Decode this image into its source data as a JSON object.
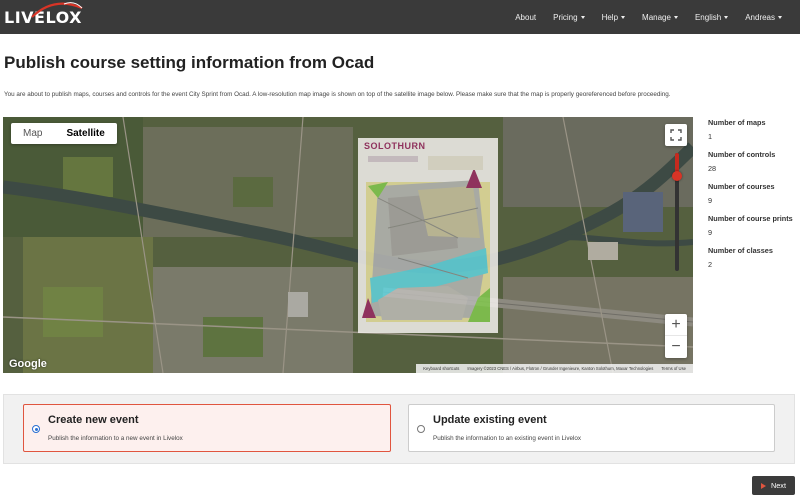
{
  "brand": {
    "name": "LIVELOX",
    "accent": "#d83426"
  },
  "nav": {
    "items": [
      {
        "label": "About",
        "dropdown": false
      },
      {
        "label": "Pricing",
        "dropdown": true
      },
      {
        "label": "Help",
        "dropdown": true
      },
      {
        "label": "Manage",
        "dropdown": true
      },
      {
        "label": "English",
        "dropdown": true
      },
      {
        "label": "Andreas",
        "dropdown": true
      }
    ]
  },
  "page": {
    "title": "Publish course setting information from Ocad",
    "intro": "You are about to publish maps, courses and controls for the event City Sprint from Ocad. A low-resolution map image is shown on top of the satellite image below. Please make sure that the map is properly georeferenced before proceeding."
  },
  "map": {
    "type_control": {
      "map_label": "Map",
      "satellite_label": "Satellite",
      "selected": "Satellite"
    },
    "overlay_title": "SOLOTHURN",
    "overlay_opacity": 0.85,
    "google_logo": "Google",
    "attribution": {
      "shortcuts": "Keyboard shortcuts",
      "imagery": "Imagery ©2023 CNES / Airbus, Flotron / Grunder Ingenieure, Kanton Solothurn, Maxar Technologies",
      "terms": "Terms of Use"
    },
    "icons": {
      "fullscreen": "fullscreen-icon",
      "zoom_in": "+",
      "zoom_out": "−"
    }
  },
  "stats": [
    {
      "label": "Number of maps",
      "value": "1"
    },
    {
      "label": "Number of controls",
      "value": "28"
    },
    {
      "label": "Number of courses",
      "value": "9"
    },
    {
      "label": "Number of course prints",
      "value": "9"
    },
    {
      "label": "Number of classes",
      "value": "2"
    }
  ],
  "options": [
    {
      "title": "Create new event",
      "description": "Publish the information to a new event in Livelox",
      "selected": true
    },
    {
      "title": "Update existing event",
      "description": "Publish the information to an existing event in Livelox",
      "selected": false
    }
  ],
  "next_button": {
    "label": "Next"
  }
}
